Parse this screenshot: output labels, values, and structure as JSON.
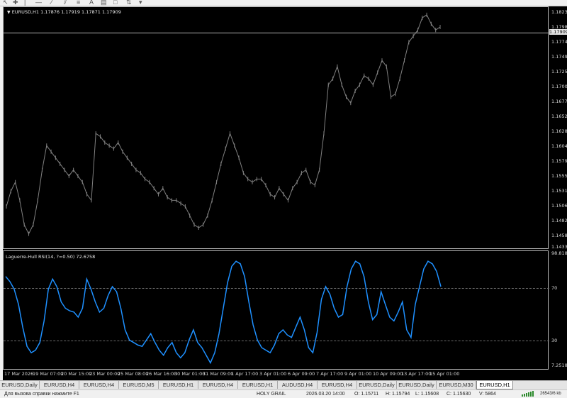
{
  "toolbar": {
    "icons": [
      "cursor-icon",
      "crosshair-icon",
      "line-icon",
      "vertical-line-icon",
      "horizontal-line-icon",
      "trendline-icon",
      "channel-icon",
      "fibonacci-icon",
      "text-icon",
      "label-icon",
      "shapes-icon"
    ]
  },
  "main_chart": {
    "info": "EURUSD,H1  1.17876 1.17919 1.17871 1.17909",
    "bid_price": "1.17909",
    "price_axis": [
      "1.18230",
      "1.17985",
      "1.17740",
      "1.17490",
      "1.17250",
      "1.17005",
      "1.16770",
      "1.16525",
      "1.16285",
      "1.16040",
      "1.15795",
      "1.15555",
      "1.15310",
      "1.15065",
      "1.14820",
      "1.14580",
      "1.14335"
    ]
  },
  "indicator": {
    "info": "Laguerre-Hull RSI(14, ?=0.50) 72.6758",
    "axis": [
      "98.8184",
      "70",
      "30",
      "7.2518"
    ]
  },
  "time_axis": [
    "17 Mar 2026",
    "19 Mar 07:00",
    "20 Mar 15:00",
    "23 Mar 00:00",
    "25 Mar 08:00",
    "26 Mar 16:00",
    "30 Mar 01:00",
    "31 Mar 09:00",
    "1 Apr 17:00",
    "3 Apr 01:00",
    "6 Apr 09:00",
    "7 Apr 17:00",
    "9 Apr 01:00",
    "10 Apr 09:00",
    "13 Apr 17:00",
    "15 Apr 01:00"
  ],
  "tabs": [
    {
      "label": "EURUSD,Daily",
      "active": false
    },
    {
      "label": "EURUSD,H4",
      "active": false
    },
    {
      "label": "EURUSD,H4",
      "active": false
    },
    {
      "label": "EURUSD,M5",
      "active": false
    },
    {
      "label": "EURUSD,H1",
      "active": false
    },
    {
      "label": "EURUSD,H4",
      "active": false
    },
    {
      "label": "EURUSD,H1",
      "active": false
    },
    {
      "label": "AUDUSD,H4",
      "active": false
    },
    {
      "label": "EURUSD,H4",
      "active": false
    },
    {
      "label": "EURUSD,Daily",
      "active": false
    },
    {
      "label": "EURUSD,Daily",
      "active": false
    },
    {
      "label": "EURUSD,M30",
      "active": false
    },
    {
      "label": "EURUSD,H1",
      "active": true
    }
  ],
  "status": {
    "help": "Для вызова справки нажмите F1",
    "profile": "HOLY GRAIL",
    "datetime": "2026.03.20 14:00",
    "open": "O: 1.15711",
    "high": "H: 1.15794",
    "low": "L: 1.15608",
    "close": "C: 1.15630",
    "volume": "V: 5864",
    "traffic": "26543/6 kb"
  },
  "colors": {
    "background": "#000000",
    "candles": "#808080",
    "indicator_line": "#1e90ff",
    "grid_levels": "#6a6a6a"
  },
  "chart_data": {
    "type": "line",
    "series": [
      {
        "name": "EURUSD,H1",
        "values": [
          1.15,
          1.1525,
          1.154,
          1.151,
          1.147,
          1.1455,
          1.147,
          1.151,
          1.156,
          1.16,
          1.159,
          1.158,
          1.157,
          1.156,
          1.155,
          1.156,
          1.155,
          1.154,
          1.152,
          1.151,
          1.162,
          1.1615,
          1.1605,
          1.16,
          1.1595,
          1.1605,
          1.159,
          1.158,
          1.157,
          1.156,
          1.1555,
          1.1545,
          1.154,
          1.153,
          1.152,
          1.153,
          1.1515,
          1.151,
          1.151,
          1.1505,
          1.15,
          1.1485,
          1.147,
          1.1465,
          1.147,
          1.1485,
          1.151,
          1.154,
          1.157,
          1.1595,
          1.162,
          1.16,
          1.158,
          1.1555,
          1.1545,
          1.154,
          1.1545,
          1.1545,
          1.1535,
          1.152,
          1.1515,
          1.153,
          1.152,
          1.151,
          1.153,
          1.154,
          1.1555,
          1.156,
          1.154,
          1.1535,
          1.156,
          1.162,
          1.17,
          1.171,
          1.173,
          1.17,
          1.168,
          1.167,
          1.169,
          1.17,
          1.1715,
          1.171,
          1.17,
          1.172,
          1.174,
          1.173,
          1.168,
          1.1685,
          1.171,
          1.174,
          1.177,
          1.178,
          1.179,
          1.181,
          1.1815,
          1.18,
          1.179,
          1.1795
        ]
      }
    ],
    "ylim": [
      1.14335,
      1.1823
    ],
    "grid": false
  },
  "indicator_data": {
    "type": "line",
    "name": "Laguerre-Hull RSI(14, ?=0.50)",
    "ylim": [
      7.2518,
      98.8184
    ],
    "levels": [
      70,
      30
    ],
    "values": [
      80,
      76,
      70,
      58,
      40,
      25,
      20,
      22,
      28,
      45,
      70,
      78,
      72,
      60,
      55,
      53,
      52,
      48,
      55,
      78,
      70,
      60,
      52,
      55,
      65,
      72,
      68,
      55,
      38,
      30,
      28,
      26,
      25,
      30,
      35,
      28,
      22,
      18,
      24,
      28,
      20,
      16,
      20,
      30,
      38,
      28,
      24,
      18,
      12,
      20,
      35,
      55,
      75,
      88,
      92,
      90,
      80,
      60,
      42,
      30,
      24,
      22,
      20,
      26,
      35,
      38,
      34,
      32,
      40,
      48,
      38,
      24,
      20,
      36,
      62,
      72,
      66,
      55,
      48,
      50,
      72,
      86,
      92,
      90,
      80,
      60,
      46,
      50,
      68,
      58,
      48,
      45,
      52,
      60,
      38,
      32,
      58,
      72,
      86,
      92,
      90,
      84,
      72
    ]
  }
}
